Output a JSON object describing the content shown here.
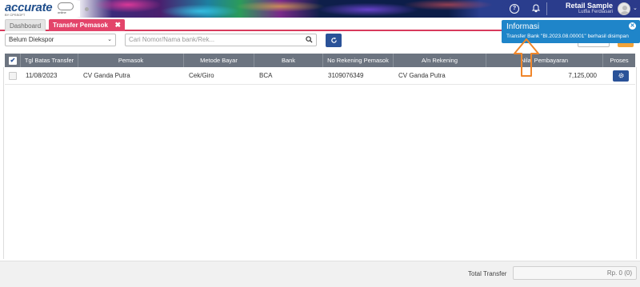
{
  "header": {
    "logo_text": "accurate",
    "logo_sub": "BY CPSSOFT",
    "logo_online": "online",
    "help_icon": "question-circle-icon",
    "bell_icon": "bell-icon",
    "user_name": "Retail Sample",
    "user_sub": "Lutfia Ferdiasari"
  },
  "tabs": [
    {
      "label": "Dashboard"
    },
    {
      "label": "Transfer Pemasok",
      "close": "✖"
    }
  ],
  "toolbar": {
    "filter_value": "Belum Diekspor",
    "search_placeholder": "Cari Nomor/Nama bank/Rek..."
  },
  "table": {
    "columns": [
      "Tgl Batas Transfer",
      "Pemasok",
      "Metode Bayar",
      "Bank",
      "No Rekening Pemasok",
      "A/n Rekening",
      "Nilai Pembayaran",
      "Proses"
    ],
    "rows": [
      {
        "date": "11/08/2023",
        "supplier": "CV Ganda Putra",
        "method": "Cek/Giro",
        "bank": "BCA",
        "account_no": "3109076349",
        "account_name": "CV Ganda Putra",
        "amount": "7,125,000"
      }
    ]
  },
  "footer": {
    "total_label": "Total Transfer",
    "total_value": "Rp. 0 (0)"
  },
  "notification": {
    "title": "Informasi",
    "message": "Transfer Bank \"BI.2023.08.00001\" berhasil disimpan",
    "color": "#1f85c9"
  },
  "colors": {
    "accent": "#e3446a",
    "primary_button": "#2a5298",
    "table_header": "#6c7480",
    "annotation_arrow": "#f0862a"
  }
}
